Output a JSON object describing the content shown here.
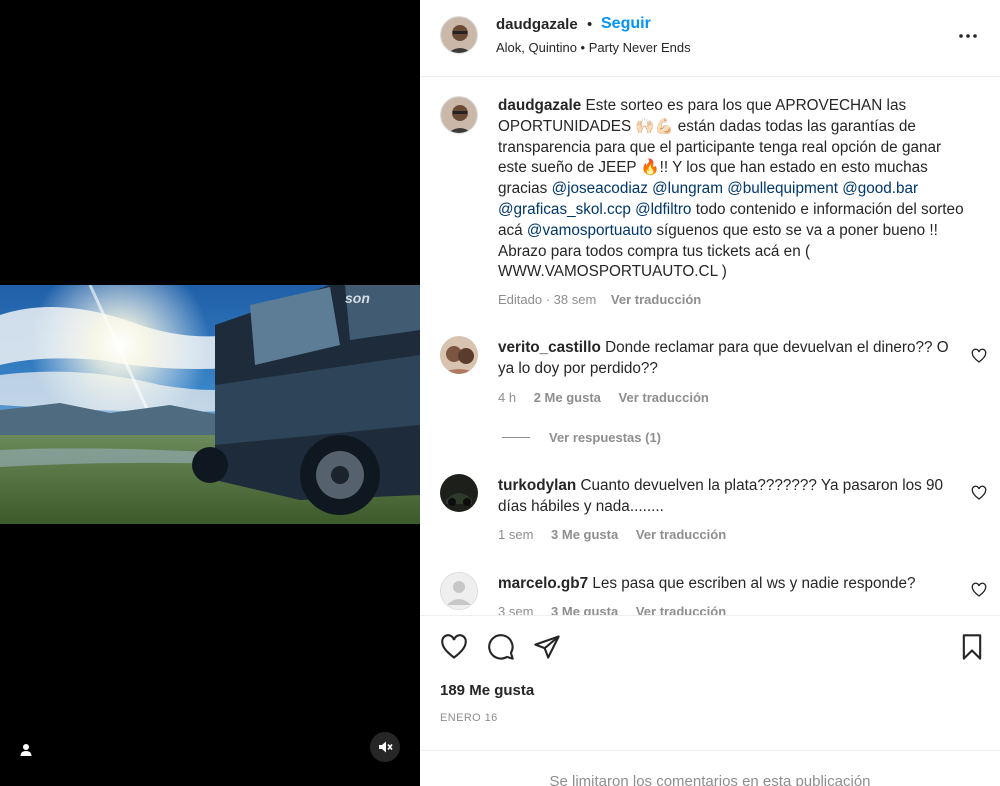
{
  "post": {
    "author": "daudgazale",
    "follow_label": "Seguir",
    "audio": "Alok, Quintino • Party Never Ends",
    "caption": {
      "username": "daudgazale",
      "parts": [
        {
          "t": "text",
          "v": " Este sorteo es para los que APROVECHAN las OPORTUNIDADES 🙌🏻💪🏻 están dadas todas las garantías de transparencia para que el participante tenga real opción de ganar este sueño de JEEP 🔥!! Y los que han estado en esto muchas gracias "
        },
        {
          "t": "mention",
          "v": "@joseacodiaz"
        },
        {
          "t": "text",
          "v": " "
        },
        {
          "t": "mention",
          "v": "@lungram"
        },
        {
          "t": "text",
          "v": " "
        },
        {
          "t": "mention",
          "v": "@bullequipment"
        },
        {
          "t": "text",
          "v": " "
        },
        {
          "t": "mention",
          "v": "@good.bar"
        },
        {
          "t": "text",
          "v": " "
        },
        {
          "t": "mention",
          "v": "@graficas_skol.ccp"
        },
        {
          "t": "text",
          "v": " "
        },
        {
          "t": "mention",
          "v": "@ldfiltro"
        },
        {
          "t": "text",
          "v": " todo contenido e información del sorteo acá "
        },
        {
          "t": "mention",
          "v": "@vamosportuauto"
        },
        {
          "t": "text",
          "v": " síguenos que esto se va a poner bueno !! Abrazo para todos compra tus tickets acá en ( WWW.VAMOSPORTUAUTO.CL )"
        }
      ],
      "edited": "Editado · 38 sem",
      "translate": "Ver traducción"
    },
    "comments": [
      {
        "username": "verito_castillo",
        "text": " Donde reclamar para que devuelvan el dinero?? O ya lo doy por perdido??",
        "time": "4 h",
        "likes": "2 Me gusta",
        "translate": "Ver traducción",
        "replies": "Ver respuestas (1)"
      },
      {
        "username": "turkodylan",
        "text": " Cuanto devuelven la plata??????? Ya pasaron los 90 días hábiles y nada........",
        "time": "1 sem",
        "likes": "3 Me gusta",
        "translate": "Ver traducción"
      },
      {
        "username": "marcelo.gb7",
        "text": " Les pasa que escriben al ws y nadie responde?",
        "time": "3 sem",
        "likes": "3 Me gusta",
        "translate": "Ver traducción"
      }
    ],
    "like_count": "189 Me gusta",
    "date": "ENERO 16",
    "comments_limited": "Se limitaron los comentarios en esta publicación"
  },
  "colors": {
    "accent": "#0095f6",
    "mention": "#00376b",
    "muted": "#8e8e8e"
  },
  "icons": [
    "more-options-icon",
    "heart-icon",
    "comment-icon",
    "share-icon",
    "bookmark-icon",
    "user-tag-icon",
    "mute-icon"
  ]
}
